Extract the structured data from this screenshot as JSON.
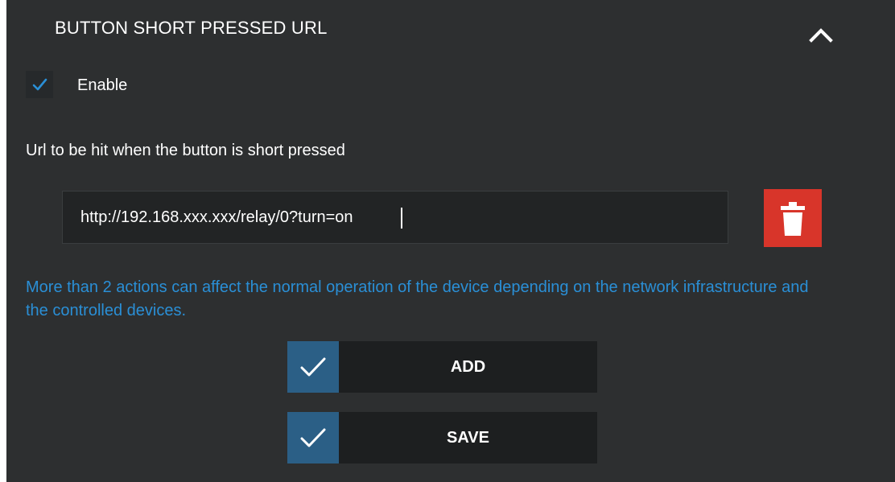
{
  "section": {
    "title": "BUTTON SHORT PRESSED URL",
    "collapse_icon": "chevron-up-icon"
  },
  "enable": {
    "label": "Enable",
    "checked": true,
    "check_icon": "check-icon"
  },
  "url_field": {
    "label": "Url to be hit when the button is short pressed",
    "value": "http://192.168.xxx.xxx/relay/0?turn=on",
    "delete_icon": "trash-icon"
  },
  "warning": {
    "text": "More than 2 actions can affect the normal operation of the device depending on the network infrastructure and the controlled devices."
  },
  "buttons": {
    "add_label": "ADD",
    "save_label": "SAVE"
  },
  "colors": {
    "background": "#2d2f30",
    "accent_blue": "#2a8fd6",
    "check_blue": "#2b5f86",
    "delete_red": "#d8352a"
  }
}
